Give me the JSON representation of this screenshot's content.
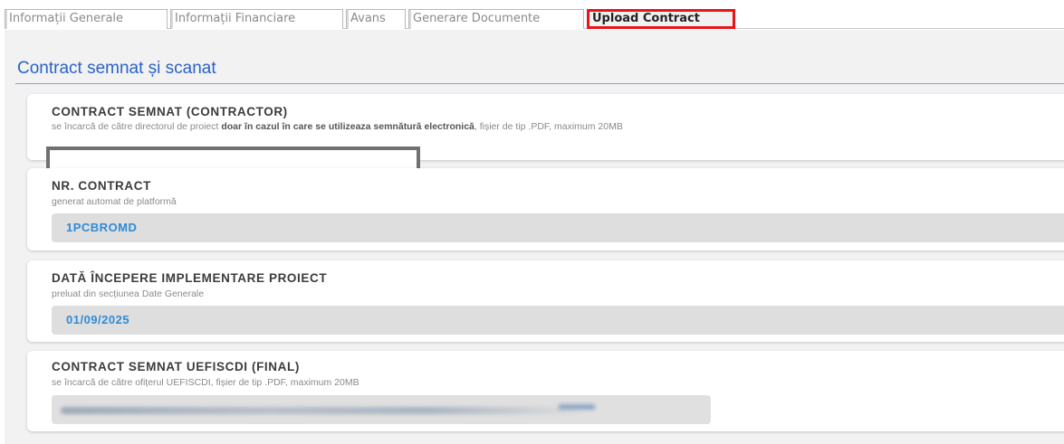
{
  "tabs": [
    {
      "label": "Informații Generale",
      "active": false
    },
    {
      "label": "Informații Financiare",
      "active": false
    },
    {
      "label": "Avans",
      "active": false
    },
    {
      "label": "Generare Documente",
      "active": false
    },
    {
      "label": "Upload Contract",
      "active": true
    }
  ],
  "section": {
    "title": "Contract semnat și scanat"
  },
  "cards": {
    "contractor": {
      "heading": "CONTRACT SEMNAT (CONTRACTOR)",
      "hint_prefix": "se încarcă de către directorul de proiect ",
      "hint_bold": "doar în cazul în care se utilizeaza semnătură electronică",
      "hint_suffix": ", fișier de tip .PDF, maximum 20MB"
    },
    "nr_contract": {
      "heading": "NR. CONTRACT",
      "hint": "generat automat de platformă",
      "value": "1PCBROMD"
    },
    "start_date": {
      "heading": "DATĂ ÎNCEPERE IMPLEMENTARE PROIECT",
      "hint": "preluat din secțiunea Date Generale",
      "value": "01/09/2025"
    },
    "uefiscdi": {
      "heading": "CONTRACT SEMNAT UEFISCDI (FINAL)",
      "hint": "se încarcă de către ofițerul UEFISCDI, fișier de tip .PDF, maximum 20MB"
    }
  },
  "colors": {
    "accent": "#2b63c6",
    "value_text": "#2f8bd7",
    "highlight": "#e8141a"
  }
}
